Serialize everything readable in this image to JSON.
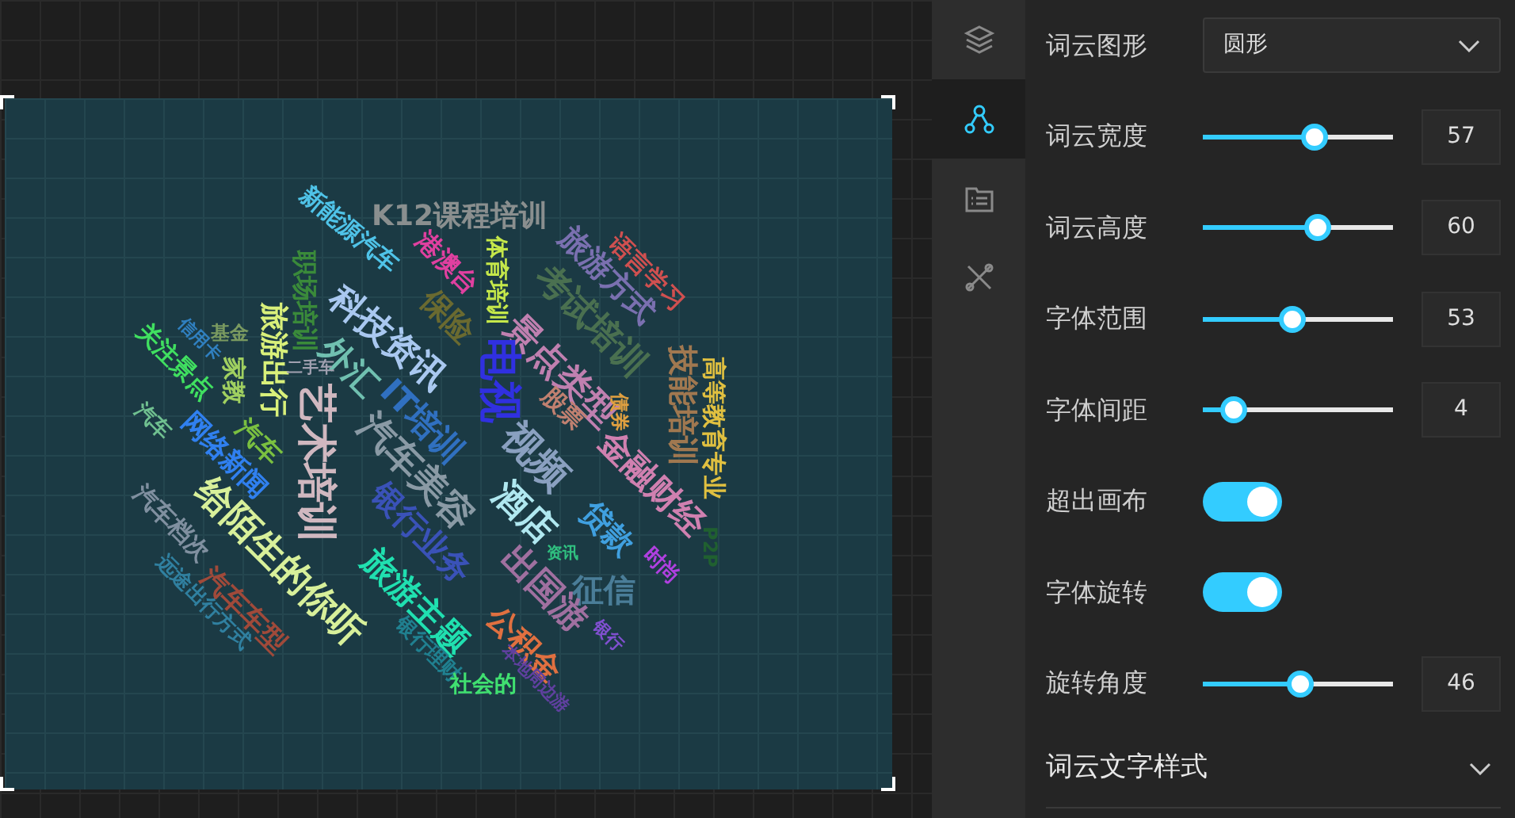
{
  "word_cloud": {
    "words": [
      {
        "text": "新能源汽车",
        "color": "#4fc3e8"
      },
      {
        "text": "K12课程培训",
        "color": "#8a8f8f"
      },
      {
        "text": "体育培训",
        "color": "#c5e84a"
      },
      {
        "text": "职场培训",
        "color": "#3a8a3a"
      },
      {
        "text": "旅游出行",
        "color": "#d9f07a"
      },
      {
        "text": "科技资讯",
        "color": "#a9c8f0"
      },
      {
        "text": "保险",
        "color": "#6a6a30"
      },
      {
        "text": "港澳台",
        "color": "#e040a0"
      },
      {
        "text": "景点类型",
        "color": "#c080b0"
      },
      {
        "text": "考试培训",
        "color": "#4a7050"
      },
      {
        "text": "旅游方式",
        "color": "#7a70b0"
      },
      {
        "text": "语言学习",
        "color": "#d05050"
      },
      {
        "text": "技能培训",
        "color": "#a07850"
      },
      {
        "text": "高等教育专业",
        "color": "#e0c040"
      },
      {
        "text": "电视",
        "color": "#3030e0"
      },
      {
        "text": "股票",
        "color": "#c08070"
      },
      {
        "text": "外汇",
        "color": "#70c0b0"
      },
      {
        "text": "IT培训",
        "color": "#3070c0"
      },
      {
        "text": "艺术培训",
        "color": "#d0b8c0"
      },
      {
        "text": "汽车美容",
        "color": "#8a9aa5"
      },
      {
        "text": "视频",
        "color": "#8aa0c0"
      },
      {
        "text": "金融财经",
        "color": "#d080b0"
      },
      {
        "text": "酒店",
        "color": "#b0e8f0"
      },
      {
        "text": "贷款",
        "color": "#40a0e0"
      },
      {
        "text": "债券",
        "color": "#e0a040"
      },
      {
        "text": "时尚",
        "color": "#b040e0"
      },
      {
        "text": "征信",
        "color": "#4a7d98"
      },
      {
        "text": "出国游",
        "color": "#a070a0"
      },
      {
        "text": "公积金",
        "color": "#e07040"
      },
      {
        "text": "银行",
        "color": "#8050d0"
      },
      {
        "text": "银行业务",
        "color": "#3a52b8"
      },
      {
        "text": "旅游主题",
        "color": "#20e0b0"
      },
      {
        "text": "给陌生的你听",
        "color": "#d8f09a"
      },
      {
        "text": "汽车车型",
        "color": "#a04a3a"
      },
      {
        "text": "远途出行方式",
        "color": "#3080a0"
      },
      {
        "text": "汽车档次",
        "color": "#8090a0"
      },
      {
        "text": "网络新闻",
        "color": "#3080f0"
      },
      {
        "text": "汽车",
        "color": "#7ac040"
      },
      {
        "text": "家教",
        "color": "#a0d060"
      },
      {
        "text": "关注景点",
        "color": "#40e060"
      },
      {
        "text": "信用卡",
        "color": "#3080c0"
      },
      {
        "text": "基金",
        "color": "#7a9a60"
      },
      {
        "text": "二手车",
        "color": "#a0a0b0"
      },
      {
        "text": "汽车",
        "color": "#70c090"
      },
      {
        "text": "银行理财",
        "color": "#208090"
      },
      {
        "text": "社会的",
        "color": "#40e070"
      },
      {
        "text": "本地周边游",
        "color": "#6040a0"
      },
      {
        "text": "P2P",
        "color": "#206030"
      },
      {
        "text": "资讯",
        "color": "#30c080"
      }
    ]
  },
  "sidebar": {
    "items": [
      {
        "selected": false
      },
      {
        "selected": true
      },
      {
        "selected": false
      },
      {
        "selected": false
      }
    ]
  },
  "settings": [
    {
      "kind": "select",
      "label": "词云图形",
      "value": "圆形"
    },
    {
      "kind": "slider",
      "label": "词云宽度",
      "level": 0.58,
      "reading": "57"
    },
    {
      "kind": "slider",
      "label": "词云高度",
      "level": 0.6,
      "reading": "60"
    },
    {
      "kind": "slider",
      "label": "字体范围",
      "level": 0.47,
      "reading": "53"
    },
    {
      "kind": "slider",
      "label": "字体间距",
      "level": 0.16,
      "reading": "4"
    },
    {
      "kind": "toggle",
      "label": "超出画布",
      "on": true
    },
    {
      "kind": "toggle",
      "label": "字体旋转",
      "on": true
    },
    {
      "kind": "slider",
      "label": "旋转角度",
      "level": 0.51,
      "reading": "46"
    }
  ],
  "section": {
    "title": "词云文字样式",
    "expanded": false
  }
}
